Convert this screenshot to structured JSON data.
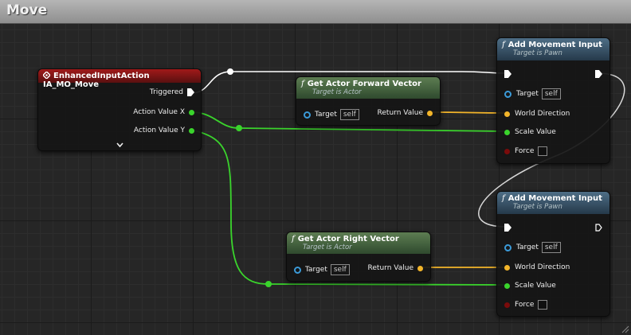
{
  "graph": {
    "title": "Move"
  },
  "input_node": {
    "title": "EnhancedInputAction IA_MO_Move",
    "pins": [
      "Triggered",
      "Action Value X",
      "Action Value Y"
    ]
  },
  "forward_node": {
    "title": "Get Actor Forward Vector",
    "subtitle": "Target is Actor",
    "target_label": "Target",
    "target_value": "self",
    "return_label": "Return Value"
  },
  "right_node": {
    "title": "Get Actor Right Vector",
    "subtitle": "Target is Actor",
    "target_label": "Target",
    "target_value": "self",
    "return_label": "Return Value"
  },
  "movement_nodes": [
    {
      "title": "Add Movement Input",
      "subtitle": "Target is Pawn",
      "target_label": "Target",
      "target_value": "self",
      "world_direction": "World Direction",
      "scale_value": "Scale Value",
      "force": "Force"
    },
    {
      "title": "Add Movement Input",
      "subtitle": "Target is Pawn",
      "target_label": "Target",
      "target_value": "self",
      "world_direction": "World Direction",
      "scale_value": "Scale Value",
      "force": "Force"
    }
  ],
  "colors": {
    "exec_wire": "#ffffff",
    "float_wire": "#3ad42c",
    "vector_wire": "#f3b52a",
    "event_header": "#a11a1a",
    "function_header": "#5d7d52",
    "pawn_header": "#4e6e86"
  }
}
